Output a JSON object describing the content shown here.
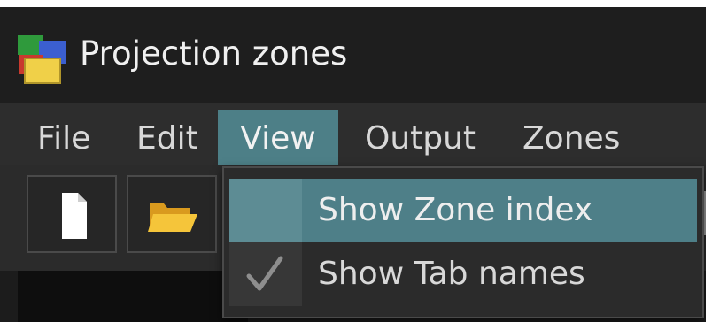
{
  "window": {
    "title": "Projection zones",
    "icon": "app-icon"
  },
  "menubar": {
    "items": [
      {
        "label": "File"
      },
      {
        "label": "Edit"
      },
      {
        "label": "View",
        "active": true
      },
      {
        "label": "Output"
      },
      {
        "label": "Zones"
      }
    ]
  },
  "toolbar": {
    "buttons": [
      {
        "icon": "new-file-icon"
      },
      {
        "icon": "open-folder-icon"
      }
    ]
  },
  "view_menu": {
    "items": [
      {
        "label": "Show Zone index",
        "checked": false,
        "highlighted": true
      },
      {
        "label": "Show Tab names",
        "checked": true,
        "highlighted": false
      }
    ]
  },
  "colors": {
    "accent": "#4d7f87",
    "background": "#1b1b1b",
    "menu_background": "#2d2d2d"
  }
}
